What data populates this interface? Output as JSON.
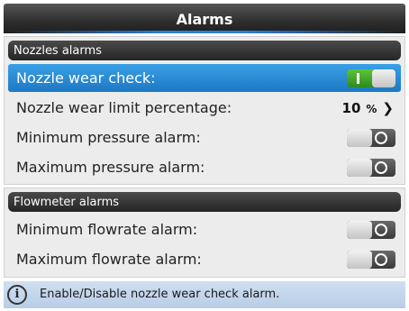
{
  "window": {
    "title": "Alarms"
  },
  "sections": [
    {
      "title": "Nozzles alarms",
      "rows": [
        {
          "label": "Nozzle wear check:",
          "type": "toggle",
          "state": "on",
          "selected": true
        },
        {
          "label": "Nozzle wear limit percentage:",
          "type": "value",
          "value": "10",
          "unit": "%",
          "chevron": "❯"
        },
        {
          "label": "Minimum pressure alarm:",
          "type": "toggle",
          "state": "off"
        },
        {
          "label": "Maximum pressure alarm:",
          "type": "toggle",
          "state": "off"
        }
      ]
    },
    {
      "title": "Flowmeter alarms",
      "rows": [
        {
          "label": "Minimum flowrate alarm:",
          "type": "toggle",
          "state": "off"
        },
        {
          "label": "Maximum flowrate alarm:",
          "type": "toggle",
          "state": "off"
        }
      ]
    }
  ],
  "status": {
    "icon": "info-icon",
    "icon_glyph": "i",
    "message": "Enable/Disable nozzle wear check alarm."
  },
  "colors": {
    "selected_row": "#1d78c4",
    "toggle_on": "#3aa62a",
    "accent": "#2a7fd8",
    "status_bg": "#c4d6ea"
  }
}
